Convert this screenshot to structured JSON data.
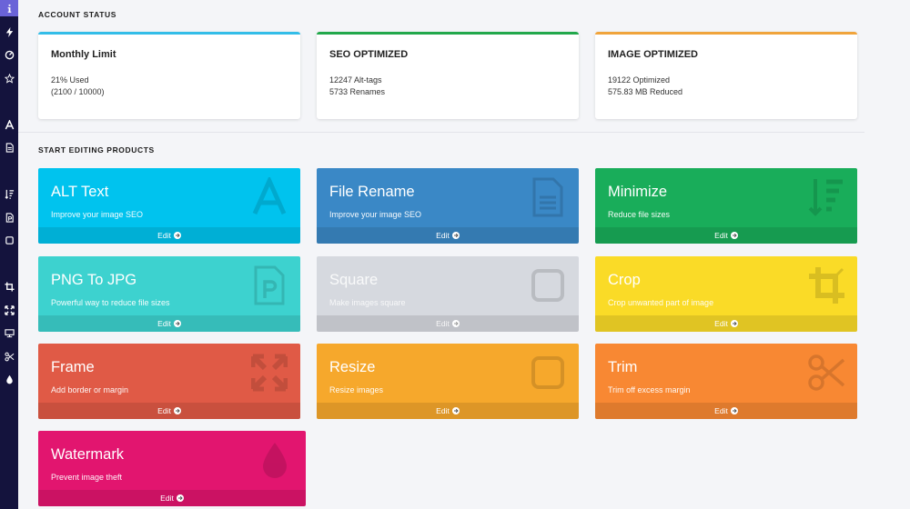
{
  "sections": {
    "account_status": "ACCOUNT STATUS",
    "start_editing": "START EDITING PRODUCTS"
  },
  "stats": [
    {
      "title": "Monthly Limit",
      "line1": "21% Used",
      "line2": "(2100 / 10000)",
      "accent": "#33bde8"
    },
    {
      "title": "SEO OPTIMIZED",
      "line1": "12247 Alt-tags",
      "line2": "5733 Renames",
      "accent": "#22a84b"
    },
    {
      "title": "IMAGE OPTIMIZED",
      "line1": "19122 Optimized",
      "line2": "575.83 MB Reduced",
      "accent": "#f0a43c"
    }
  ],
  "tiles": [
    {
      "name": "ALT Text",
      "desc": "Improve your image SEO",
      "edit": "Edit",
      "color": "#00c3ee",
      "icon": "font-icon"
    },
    {
      "name": "File Rename",
      "desc": "Improve your image SEO",
      "edit": "Edit",
      "color": "#3a88c6",
      "icon": "file-icon"
    },
    {
      "name": "Minimize",
      "desc": "Reduce file sizes",
      "edit": "Edit",
      "color": "#19ad5a",
      "icon": "sort-amount-icon"
    },
    {
      "name": "PNG To JPG",
      "desc": "Powerful way to reduce file sizes",
      "edit": "Edit",
      "color": "#3dd2cf",
      "icon": "file-powerpoint-icon"
    },
    {
      "name": "Square",
      "desc": "Make images square",
      "edit": "Edit",
      "color": "#d6d9df",
      "icon": "square-icon"
    },
    {
      "name": "Crop",
      "desc": "Crop unwanted part of image",
      "edit": "Edit",
      "color": "#fadb27",
      "icon": "crop-icon"
    },
    {
      "name": "Frame",
      "desc": "Add border or margin",
      "edit": "Edit",
      "color": "#e05a46",
      "icon": "expand-icon"
    },
    {
      "name": "Resize",
      "desc": "Resize images",
      "edit": "Edit",
      "color": "#f6a82c",
      "icon": "square-icon"
    },
    {
      "name": "Trim",
      "desc": "Trim off excess margin",
      "edit": "Edit",
      "color": "#f88833",
      "icon": "scissors-icon"
    },
    {
      "name": "Watermark",
      "desc": "Prevent image theft",
      "edit": "Edit",
      "color": "#e2156f",
      "icon": "tint-icon"
    }
  ],
  "sidebar_icons": [
    "info-icon",
    "bolt-icon",
    "dashboard-icon",
    "star-icon",
    "font-icon",
    "file-icon",
    "sort-amount-icon",
    "file-powerpoint-icon",
    "square-icon",
    "crop-icon",
    "expand-icon",
    "resize-icon",
    "scissors-icon",
    "tint-icon"
  ]
}
